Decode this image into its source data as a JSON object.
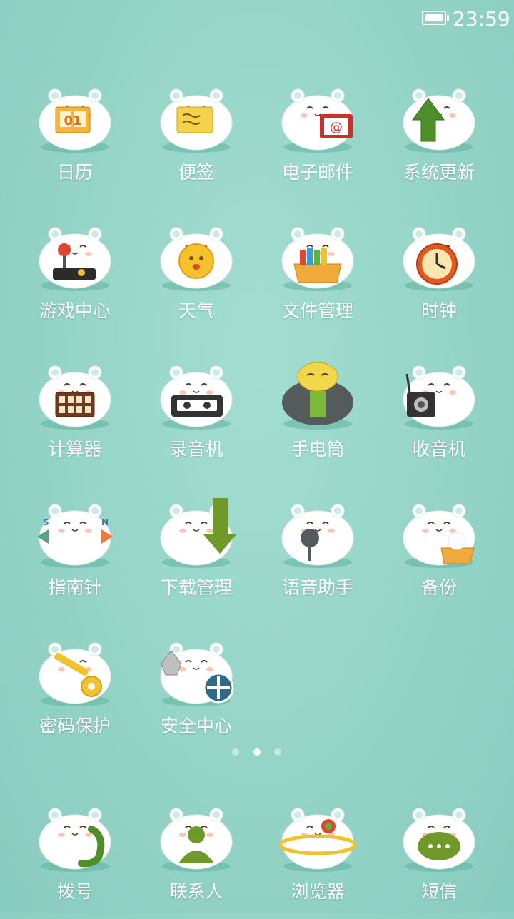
{
  "status_bar": {
    "time": "23:59"
  },
  "apps": [
    {
      "label": "日历",
      "icon": "calendar-icon",
      "badge_text": "01"
    },
    {
      "label": "便签",
      "icon": "notes-icon"
    },
    {
      "label": "电子邮件",
      "icon": "email-icon",
      "badge_text": "@"
    },
    {
      "label": "系统更新",
      "icon": "system-update-icon"
    },
    {
      "label": "游戏中心",
      "icon": "game-center-icon"
    },
    {
      "label": "天气",
      "icon": "weather-icon"
    },
    {
      "label": "文件管理",
      "icon": "file-manager-icon"
    },
    {
      "label": "时钟",
      "icon": "clock-icon"
    },
    {
      "label": "计算器",
      "icon": "calculator-icon"
    },
    {
      "label": "录音机",
      "icon": "recorder-icon"
    },
    {
      "label": "手电筒",
      "icon": "flashlight-icon"
    },
    {
      "label": "收音机",
      "icon": "radio-icon"
    },
    {
      "label": "指南针",
      "icon": "compass-icon",
      "dir_s": "S",
      "dir_n": "N"
    },
    {
      "label": "下载管理",
      "icon": "download-manager-icon"
    },
    {
      "label": "语音助手",
      "icon": "voice-assistant-icon"
    },
    {
      "label": "备份",
      "icon": "backup-icon"
    },
    {
      "label": "密码保护",
      "icon": "password-protection-icon"
    },
    {
      "label": "安全中心",
      "icon": "security-center-icon"
    }
  ],
  "page_indicator": {
    "count": 3,
    "active_index": 1
  },
  "dock": [
    {
      "label": "拨号",
      "icon": "dialer-icon"
    },
    {
      "label": "联系人",
      "icon": "contacts-icon"
    },
    {
      "label": "浏览器",
      "icon": "browser-icon"
    },
    {
      "label": "短信",
      "icon": "messages-icon"
    }
  ]
}
